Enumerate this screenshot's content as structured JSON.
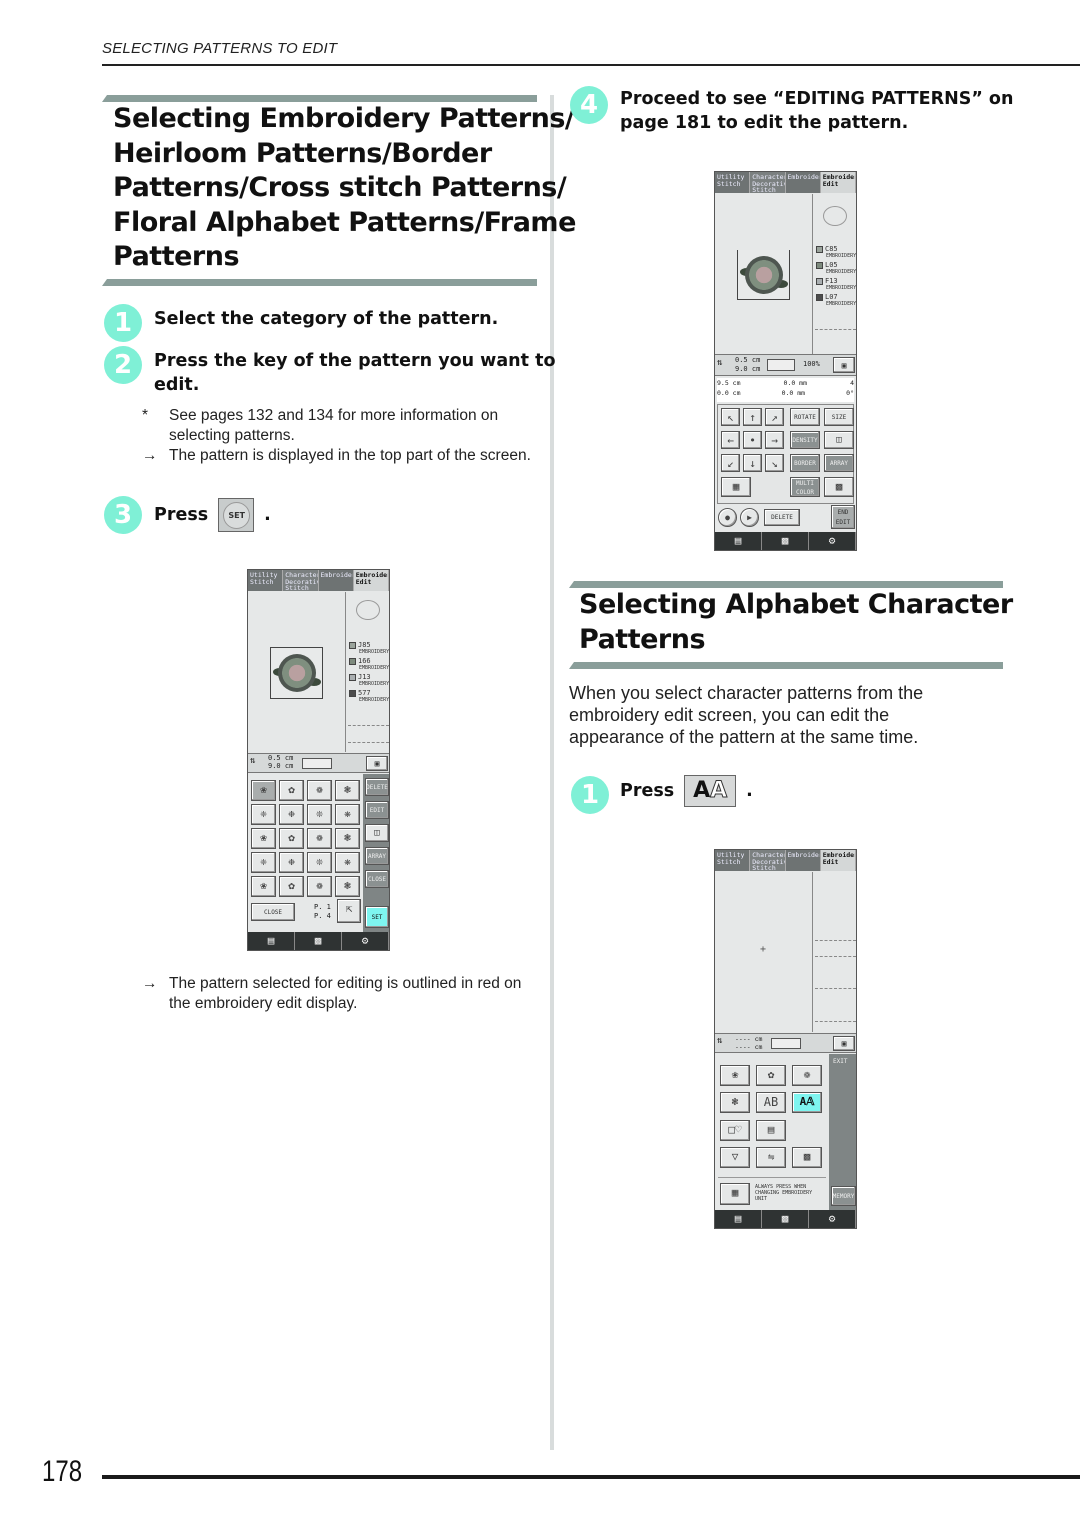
{
  "running_head": "SELECTING PATTERNS TO EDIT",
  "section1": {
    "title_lines": [
      "Selecting Embroidery Patterns/",
      "Heirloom Patterns/Border",
      "Patterns/Cross stitch Patterns/",
      "Floral Alphabet Patterns/Frame",
      "Patterns"
    ],
    "steps": [
      {
        "number": "1",
        "text": "Select the category of the pattern."
      },
      {
        "number": "2",
        "text_lines": [
          "Press the key of the pattern you want to",
          "edit."
        ]
      },
      {
        "number": "3",
        "text": "Press",
        "button": "SET",
        "suffix": "."
      },
      {
        "number": "4",
        "text_lines": [
          "Proceed to see “EDITING PATTERNS” on",
          "page 181 to edit the pattern."
        ]
      }
    ],
    "notes": [
      {
        "mark": "*",
        "lines": [
          "See pages 132 and 134 for more information on",
          "selecting patterns."
        ]
      },
      {
        "mark": "→",
        "lines": [
          "The pattern is displayed in the top part of the screen."
        ]
      }
    ],
    "result_note": {
      "mark": "→",
      "lines": [
        "The pattern selected for editing is outlined in red on",
        "the embroidery edit display."
      ]
    }
  },
  "section2": {
    "title_lines": [
      "Selecting Alphabet Character",
      "Patterns"
    ],
    "intro_lines": [
      "When you select character patterns from the",
      "embroidery edit screen, you can edit the",
      "appearance of the pattern at the same time."
    ],
    "step": {
      "number": "1",
      "text": "Press",
      "button": "AA",
      "suffix": "."
    }
  },
  "screens": {
    "tabs": [
      {
        "label": "Utility\nStitch"
      },
      {
        "label": "Character\nDecorative\nStitch"
      },
      {
        "label": "Embroidery"
      },
      {
        "label": "Embroidery\nEdit"
      }
    ],
    "screen_a": {
      "threads": [
        {
          "code": "J85",
          "name": "EMBROIDERY",
          "color": "#9aa39b"
        },
        {
          "code": "166",
          "name": "EMBROIDERY",
          "color": "#7d8a7d"
        },
        {
          "code": "J13",
          "name": "EMBROIDERY",
          "color": "#a9aeb0"
        },
        {
          "code": "577",
          "name": "EMBROIDERY",
          "color": "#4c4c4c"
        }
      ],
      "size_h": "0.5 cm",
      "size_w": "9.0 cm",
      "side_keys": [
        "DELETE",
        "EDIT",
        "",
        "ARRAY",
        "CLOSE"
      ],
      "close_label": "CLOSE",
      "page_current": "P. 1",
      "page_total": "P. 4",
      "set_label": "SET"
    },
    "screen_b": {
      "threads": [
        {
          "code": "C85",
          "name": "EMBROIDERY",
          "color": "#9aa39b"
        },
        {
          "code": "L05",
          "name": "EMBROIDERY",
          "color": "#7d8a7d"
        },
        {
          "code": "F13",
          "name": "EMBROIDERY",
          "color": "#a9aeb0"
        },
        {
          "code": "L07",
          "name": "EMBROIDERY",
          "color": "#4c4c4c"
        }
      ],
      "size_h": "0.5 cm",
      "size_w": "9.0 cm",
      "zoom": "100%",
      "info": [
        "9.5 cm",
        "0.0 mm",
        "4",
        "0.0 cm",
        "0.0 mm",
        "0°"
      ],
      "keys": [
        "ROTATE",
        "SIZE",
        "DENSITY",
        "BORDER",
        "ARRAY",
        "MULTI COLOR",
        "DELETE",
        "END EDIT"
      ]
    },
    "screen_c": {
      "size_h": "---- cm",
      "size_w": "---- cm",
      "side_top": "EXIT",
      "side_bottom": "MEMORY",
      "note": "ALWAYS PRESS WHEN CHANGING EMBROIDERY UNIT"
    }
  },
  "page_number": "178"
}
